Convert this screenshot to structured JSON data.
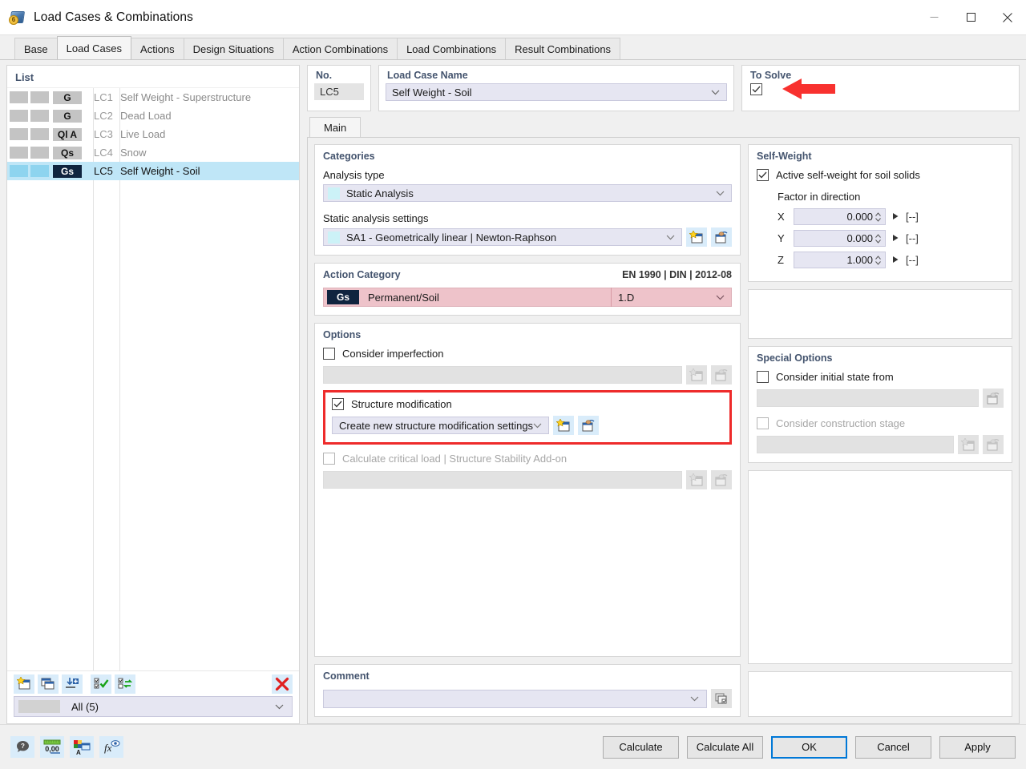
{
  "window": {
    "title": "Load Cases & Combinations",
    "icon": "app-cube-icon",
    "minimize_label": "Minimize",
    "maximize_label": "Maximize",
    "close_label": "Close"
  },
  "tabs": [
    {
      "label": "Base",
      "active": false
    },
    {
      "label": "Load Cases",
      "active": true
    },
    {
      "label": "Actions",
      "active": false
    },
    {
      "label": "Design Situations",
      "active": false
    },
    {
      "label": "Action Combinations",
      "active": false
    },
    {
      "label": "Load Combinations",
      "active": false
    },
    {
      "label": "Result Combinations",
      "active": false
    }
  ],
  "list_panel": {
    "header": "List",
    "rows": [
      {
        "category": "G",
        "no": "LC1",
        "name": "Self Weight - Superstructure",
        "selected": false
      },
      {
        "category": "G",
        "no": "LC2",
        "name": "Dead Load",
        "selected": false
      },
      {
        "category": "Ql A",
        "no": "LC3",
        "name": "Live Load",
        "selected": false
      },
      {
        "category": "Qs",
        "no": "LC4",
        "name": "Snow",
        "selected": false
      },
      {
        "category": "Gs",
        "no": "LC5",
        "name": "Self Weight - Soil",
        "selected": true
      }
    ],
    "toolbar": [
      {
        "name": "new-load-case-button",
        "icon": "new-window-star-icon"
      },
      {
        "name": "copy-load-case-button",
        "icon": "copy-windows-icon"
      },
      {
        "name": "import-load-case-button",
        "icon": "import-plus-icon"
      },
      {
        "name": "select-all-button",
        "icon": "checklist-check-icon"
      },
      {
        "name": "invert-selection-button",
        "icon": "checklist-swap-icon"
      },
      {
        "name": "delete-load-case-button",
        "icon": "red-x-icon"
      }
    ],
    "filter": {
      "value": "All (5)",
      "caret": "chevron-down-icon"
    }
  },
  "header_fields": {
    "no": {
      "label": "No.",
      "value": "LC5"
    },
    "name": {
      "label": "Load Case Name",
      "value": "Self Weight - Soil",
      "caret": "chevron-down-icon"
    },
    "to_solve": {
      "label": "To Solve",
      "checked": true,
      "annotation": "red-arrow-pointer"
    }
  },
  "inner_tab": {
    "label": "Main"
  },
  "categories": {
    "title": "Categories",
    "analysis_type": {
      "label": "Analysis type",
      "value": "Static Analysis"
    },
    "static_settings": {
      "label": "Static analysis settings",
      "value": "SA1 - Geometrically linear | Newton-Raphson",
      "new_button": "new-settings-icon",
      "edit_button": "edit-settings-icon"
    }
  },
  "action_category": {
    "title": "Action Category",
    "standard": "EN 1990 | DIN | 2012-08",
    "badge": "Gs",
    "name": "Permanent/Soil",
    "sub_value": "1.D"
  },
  "options": {
    "title": "Options",
    "consider_imperfection": {
      "label": "Consider imperfection",
      "checked": false,
      "enabled": true,
      "field_value": ""
    },
    "structure_modification": {
      "label": "Structure modification",
      "checked": true,
      "enabled": true,
      "field_value": "Create new structure modification settings",
      "highlighted": true
    },
    "calculate_critical_load": {
      "label": "Calculate critical load | Structure Stability Add-on",
      "checked": false,
      "enabled": false,
      "field_value": ""
    }
  },
  "self_weight": {
    "title": "Self-Weight",
    "active_checkbox": {
      "label": "Active self-weight for soil solids",
      "checked": true
    },
    "factor_label": "Factor in direction",
    "factors": [
      {
        "axis": "X",
        "value": "0.000",
        "unit": "[--]"
      },
      {
        "axis": "Y",
        "value": "0.000",
        "unit": "[--]"
      },
      {
        "axis": "Z",
        "value": "1.000",
        "unit": "[--]"
      }
    ]
  },
  "special_options": {
    "title": "Special Options",
    "consider_initial_state": {
      "label": "Consider initial state from",
      "checked": false,
      "enabled": true,
      "field_value": ""
    },
    "consider_construction_stage": {
      "label": "Consider construction stage",
      "checked": false,
      "enabled": false,
      "field_value": ""
    }
  },
  "comment": {
    "title": "Comment",
    "value": "",
    "caret": "chevron-down-icon",
    "button": "comment-templates-icon"
  },
  "footer": {
    "tools": [
      {
        "name": "help-button",
        "icon": "help-bubble-icon"
      },
      {
        "name": "units-button",
        "icon": "units-ruler-icon"
      },
      {
        "name": "display-properties-button",
        "icon": "colors-palette-icon"
      },
      {
        "name": "formula-button",
        "icon": "fx-eye-icon"
      }
    ],
    "buttons": [
      {
        "label": "Calculate",
        "primary": false
      },
      {
        "label": "Calculate All",
        "primary": false
      },
      {
        "label": "OK",
        "primary": true
      },
      {
        "label": "Cancel",
        "primary": false
      },
      {
        "label": "Apply",
        "primary": false
      }
    ]
  },
  "colors": {
    "accent_blue": "#0078d7",
    "header_blue": "#44546e",
    "selection_blue": "#bfe6f7",
    "highlight_red": "#ee2b2b",
    "action_pink": "#eec3ca",
    "field_lavender": "#e6e6f2",
    "badge_dark": "#10243f"
  }
}
